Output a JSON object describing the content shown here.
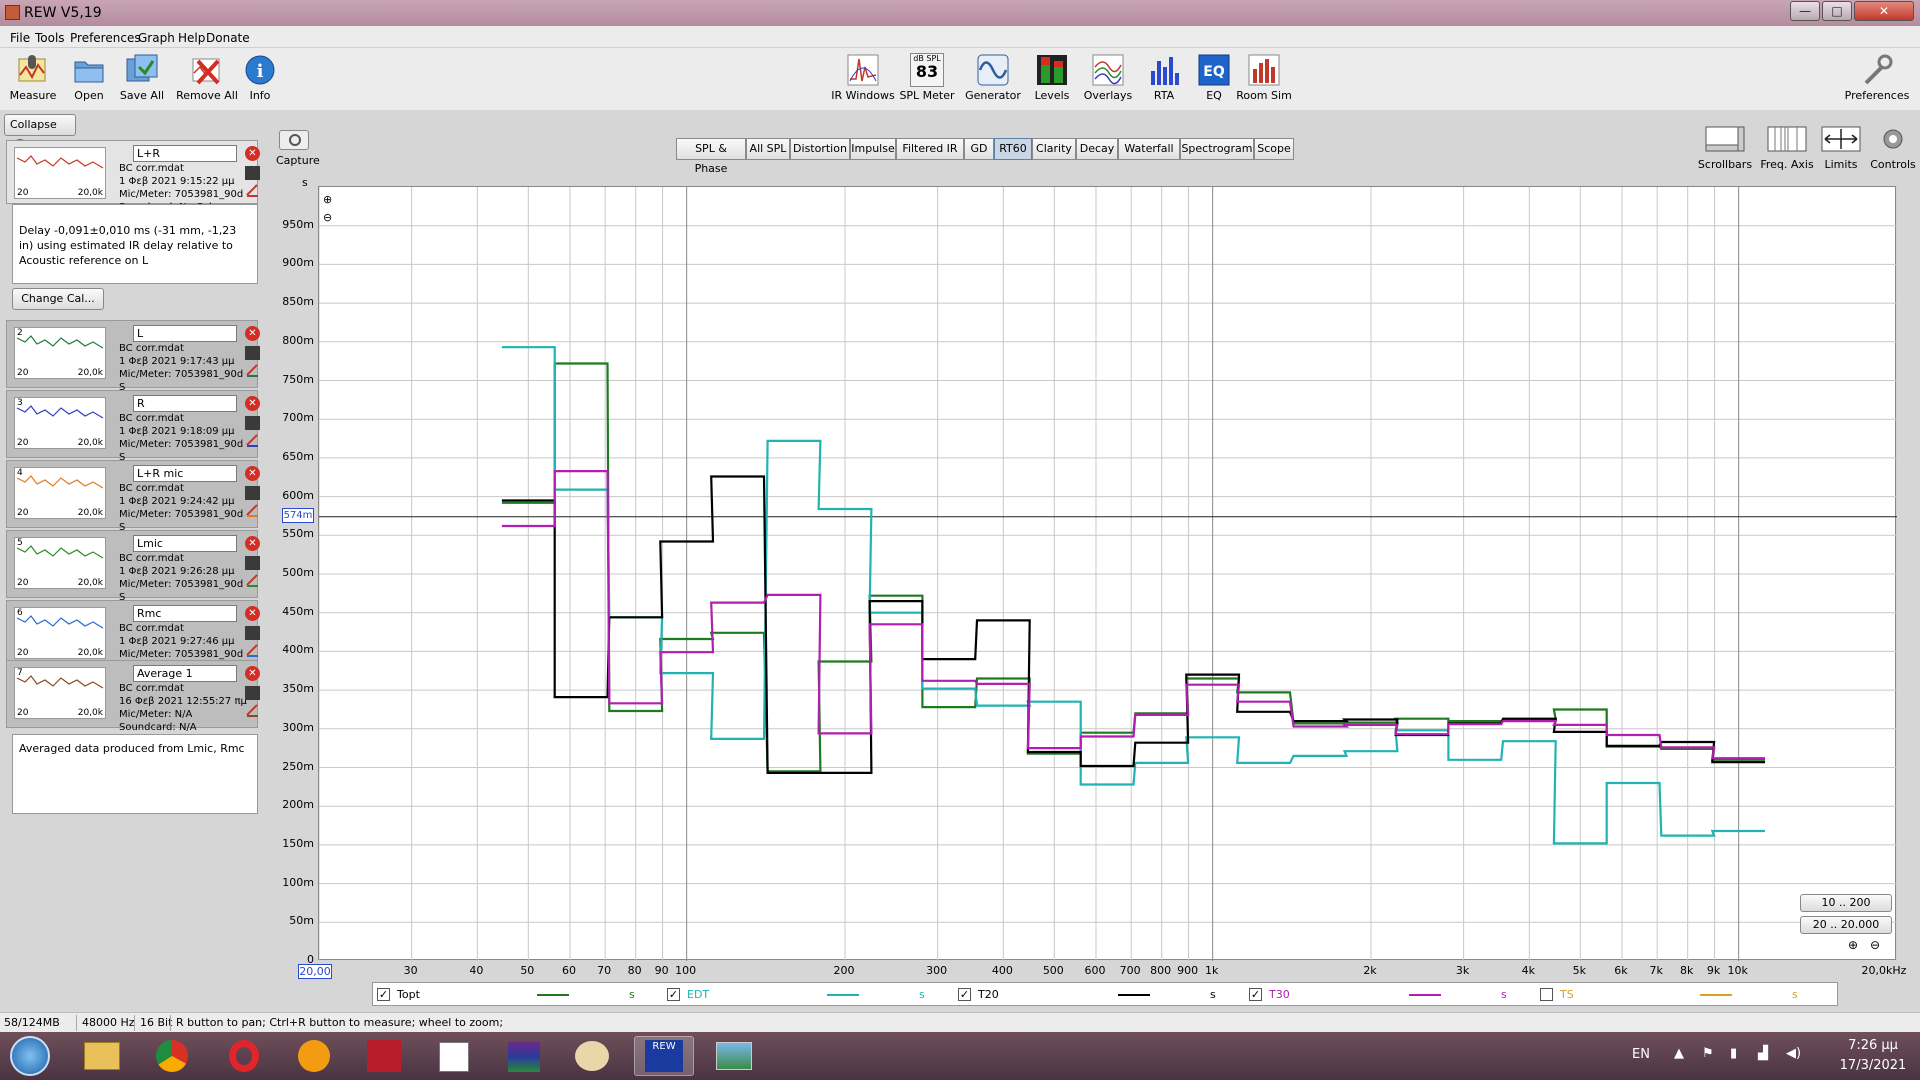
{
  "window": {
    "title": "REW V5,19",
    "minimize": "—",
    "maximize": "□",
    "close": "✕"
  },
  "menu": [
    "File",
    "Tools",
    "Preferences",
    "Graph",
    "Help",
    "Donate"
  ],
  "toolbar_left": [
    {
      "label": "Measure",
      "icon": "microphone-icon"
    },
    {
      "label": "Open",
      "icon": "folder-open-icon"
    },
    {
      "label": "Save All",
      "icon": "save-all-icon"
    },
    {
      "label": "Remove All",
      "icon": "remove-all-icon"
    },
    {
      "label": "Info",
      "icon": "info-icon"
    }
  ],
  "toolbar_center": [
    {
      "label": "IR Windows",
      "icon": "ir-windows-icon"
    },
    {
      "label": "SPL Meter",
      "icon": "spl-meter-icon",
      "readout_top": "dB SPL",
      "readout_value": "83"
    },
    {
      "label": "Generator",
      "icon": "generator-icon"
    },
    {
      "label": "Levels",
      "icon": "levels-icon"
    },
    {
      "label": "Overlays",
      "icon": "overlays-icon"
    },
    {
      "label": "RTA",
      "icon": "rta-icon"
    },
    {
      "label": "EQ",
      "icon": "eq-icon"
    },
    {
      "label": "Room Sim",
      "icon": "room-sim-icon"
    }
  ],
  "preferences_label": "Preferences",
  "collapse_label": "Collapse",
  "measurements": [
    {
      "num": "",
      "name": "L+R",
      "file": "BC corr.mdat",
      "date": "1 Φεβ 2021 9:15:22 μμ",
      "mic": "Mic/Meter: 7053981_90d",
      "soundcard": "Soundcard: No Cal",
      "color": "#c0392b",
      "lo": "20",
      "hi": "20,0k"
    },
    {
      "num": "2",
      "name": "L",
      "file": "BC corr.mdat",
      "date": "1 Φεβ 2021 9:17:43 μμ",
      "mic": "Mic/Meter: 7053981_90d",
      "soundcard": "S",
      "color": "#1e7a3a",
      "lo": "20",
      "hi": "20,0k"
    },
    {
      "num": "3",
      "name": "R",
      "file": "BC corr.mdat",
      "date": "1 Φεβ 2021 9:18:09 μμ",
      "mic": "Mic/Meter: 7053981_90d",
      "soundcard": "S",
      "color": "#3a3ac0",
      "lo": "20",
      "hi": "20,0k"
    },
    {
      "num": "4",
      "name": "L+R  mic",
      "file": "BC corr.mdat",
      "date": "1 Φεβ 2021 9:24:42 μμ",
      "mic": "Mic/Meter: 7053981_90d",
      "soundcard": "S",
      "color": "#e07a20",
      "lo": "20",
      "hi": "20,0k"
    },
    {
      "num": "5",
      "name": "Lmic",
      "file": "BC corr.mdat",
      "date": "1 Φεβ 2021 9:26:28 μμ",
      "mic": "Mic/Meter: 7053981_90d",
      "soundcard": "S",
      "color": "#2a8a2a",
      "lo": "20",
      "hi": "20,0k"
    },
    {
      "num": "6",
      "name": "Rmc",
      "file": "BC corr.mdat",
      "date": "1 Φεβ 2021 9:27:46 μμ",
      "mic": "Mic/Meter: 7053981_90d",
      "soundcard": "S",
      "color": "#2a6ad0",
      "lo": "20",
      "hi": "20,0k"
    },
    {
      "num": "7",
      "name": "Average 1",
      "file": "BC corr.mdat",
      "date": "16 Φεβ 2021 12:55:27 πμ",
      "mic": "Mic/Meter: N/A",
      "soundcard": "Soundcard: N/A",
      "color": "#8a4a20",
      "lo": "20",
      "hi": "20,0k"
    }
  ],
  "delay_note": "Delay -0,091±0,010 ms (-31 mm, -1,23 in) using estimated IR delay relative to Acoustic reference on  L",
  "change_cal_label": "Change Cal...",
  "average_note": "Averaged data produced from Lmic, Rmc",
  "capture_label": "Capture",
  "graph_tabs": [
    "SPL & Phase",
    "All SPL",
    "Distortion",
    "Impulse",
    "Filtered IR",
    "GD",
    "RT60",
    "Clarity",
    "Decay",
    "Waterfall",
    "Spectrogram",
    "Scope"
  ],
  "active_tab": "RT60",
  "right_tools": [
    "Scrollbars",
    "Freq. Axis",
    "Limits",
    "Controls"
  ],
  "range_buttons": [
    "10 .. 200",
    "20 .. 20.000"
  ],
  "status": {
    "memory": "58/124MB",
    "rate": "48000 Hz",
    "bits": "16 Bit",
    "hint": "R button to pan; Ctrl+R button to measure; wheel to zoom;"
  },
  "taskbar": {
    "lang": "EN",
    "time": "7:26 μμ",
    "date": "17/3/2021",
    "apps": [
      "start-orb-icon",
      "explorer-icon",
      "chrome-icon",
      "opera-icon",
      "browser-icon",
      "app-red-icon",
      "notepad-icon",
      "winrar-icon",
      "paint-icon",
      "rew-icon",
      "photo-viewer-icon"
    ]
  },
  "chart_data": {
    "type": "line",
    "ylabel": "s",
    "xlabel": "",
    "x_scale": "log",
    "xlim": [
      20,
      20000
    ],
    "ylim": [
      0,
      1.0
    ],
    "x_ticks": [
      "20,00",
      "30",
      "40",
      "50",
      "60",
      "70",
      "80",
      "90",
      "100",
      "200",
      "300",
      "400",
      "500",
      "600",
      "700",
      "800",
      "900",
      "1k",
      "2k",
      "3k",
      "4k",
      "5k",
      "6k",
      "7k",
      "8k",
      "9k",
      "10k",
      "20,0kHz"
    ],
    "x_tick_values": [
      20,
      30,
      40,
      50,
      60,
      70,
      80,
      90,
      100,
      200,
      300,
      400,
      500,
      600,
      700,
      800,
      900,
      1000,
      2000,
      3000,
      4000,
      5000,
      6000,
      7000,
      8000,
      9000,
      10000,
      20000
    ],
    "y_ticks": [
      "0",
      "50m",
      "100m",
      "150m",
      "200m",
      "250m",
      "300m",
      "350m",
      "400m",
      "450m",
      "500m",
      "550m",
      "600m",
      "650m",
      "700m",
      "750m",
      "800m",
      "850m",
      "900m",
      "950m"
    ],
    "cursor_value": "574m",
    "cursor_y": 0.574,
    "band_centers": [
      50,
      63,
      80,
      100,
      125,
      160,
      200,
      250,
      315,
      400,
      500,
      630,
      800,
      1000,
      1250,
      1600,
      2000,
      2500,
      3150,
      4000,
      5000,
      6300,
      8000,
      10000
    ],
    "series": [
      {
        "name": "Topt",
        "color": "#1f7a1f",
        "checked": true,
        "unit": "s",
        "values": [
          0.592,
          0.772,
          0.323,
          0.416,
          0.424,
          0.245,
          0.387,
          0.472,
          0.328,
          0.365,
          0.268,
          0.295,
          0.32,
          0.365,
          0.347,
          0.307,
          0.308,
          0.313,
          0.31,
          0.312,
          0.325,
          0.277,
          0.274,
          0.26
        ]
      },
      {
        "name": "EDT",
        "color": "#1fb3b3",
        "checked": true,
        "unit": "s",
        "values": [
          0.793,
          0.609,
          0.444,
          0.372,
          0.287,
          0.672,
          0.584,
          0.45,
          0.352,
          0.33,
          0.335,
          0.228,
          0.256,
          0.289,
          0.256,
          0.265,
          0.271,
          0.298,
          0.26,
          0.284,
          0.152,
          0.23,
          0.162,
          0.168
        ]
      },
      {
        "name": "T20",
        "color": "#000000",
        "checked": true,
        "unit": "s",
        "values": [
          0.595,
          0.341,
          0.444,
          0.542,
          0.626,
          0.243,
          0.243,
          0.465,
          0.39,
          0.44,
          0.27,
          0.252,
          0.282,
          0.37,
          0.322,
          0.31,
          0.312,
          0.292,
          0.307,
          0.313,
          0.296,
          0.278,
          0.283,
          0.257
        ]
      },
      {
        "name": "T30",
        "color": "#b01fb0",
        "checked": true,
        "unit": "s",
        "values": [
          0.562,
          0.633,
          0.333,
          0.399,
          0.463,
          0.473,
          0.294,
          0.435,
          0.362,
          0.358,
          0.275,
          0.29,
          0.318,
          0.357,
          0.335,
          0.303,
          0.305,
          0.293,
          0.306,
          0.31,
          0.305,
          0.292,
          0.276,
          0.262
        ]
      },
      {
        "name": "TS",
        "color": "#d9a21f",
        "checked": false,
        "unit": "s",
        "values": []
      }
    ]
  }
}
